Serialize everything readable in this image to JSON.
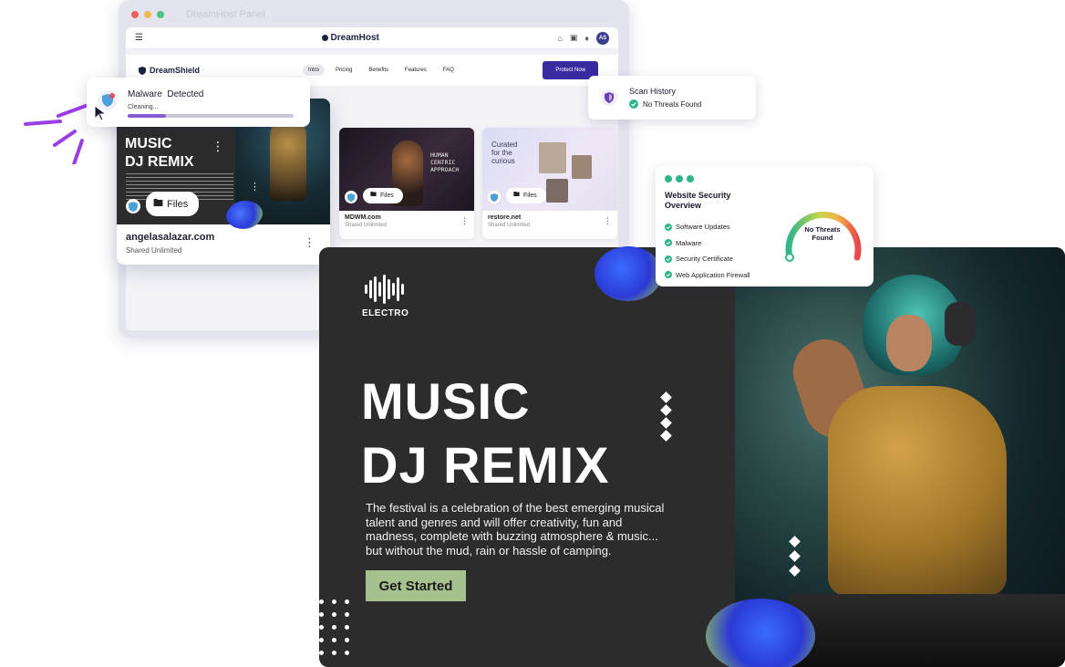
{
  "browser": {
    "window_title": "DreamHost Panel",
    "brand": "DreamHost",
    "avatar_initials": "AS"
  },
  "site_nav": {
    "logo": "DreamShield",
    "links": [
      "Intro",
      "Pricing",
      "Benefits",
      "Features",
      "FAQ"
    ],
    "active_link": "Intro",
    "cta": "Protect Now"
  },
  "sites": [
    {
      "name": "angelasalazar.com",
      "plan": "Shared Unlimited",
      "files_label": "Files",
      "thumb_title_1": "MUSIC",
      "thumb_title_2": "DJ REMIX"
    },
    {
      "name": "MDWM.com",
      "plan": "Shared Unlimited",
      "files_label": "Files",
      "thumb_title": "HUMAN CENTRIC APPROACH"
    },
    {
      "name": "restore.net",
      "plan": "Shared Unlimited",
      "files_label": "Files",
      "thumb_title": "Curated for the curious"
    }
  ],
  "malware": {
    "title": "Malware  Detected",
    "status": "Cleaning...",
    "progress": 0.23
  },
  "scan_history": {
    "title": "Scan History",
    "status": "No Threats Found"
  },
  "overview": {
    "title": "Website Security Overview",
    "items": [
      "Software Updates",
      "Malware",
      "Security Certificate",
      "Web Application Firewall"
    ],
    "gauge_label": "No Threats Found",
    "colors": {
      "ok": "#2fb58b"
    }
  },
  "banner": {
    "logo_text": "ELECTRO",
    "headline_1": "MUSIC",
    "headline_2": "DJ REMIX",
    "paragraph": "The festival is a celebration of the best emerging musical talent and genres and will offer creativity, fun and madness, complete with buzzing atmosphere & music... but without the mud, rain or hassle of camping.",
    "cta": "Get Started",
    "colors": {
      "background": "#2d2c2c",
      "cta": "#a7c18e"
    }
  }
}
